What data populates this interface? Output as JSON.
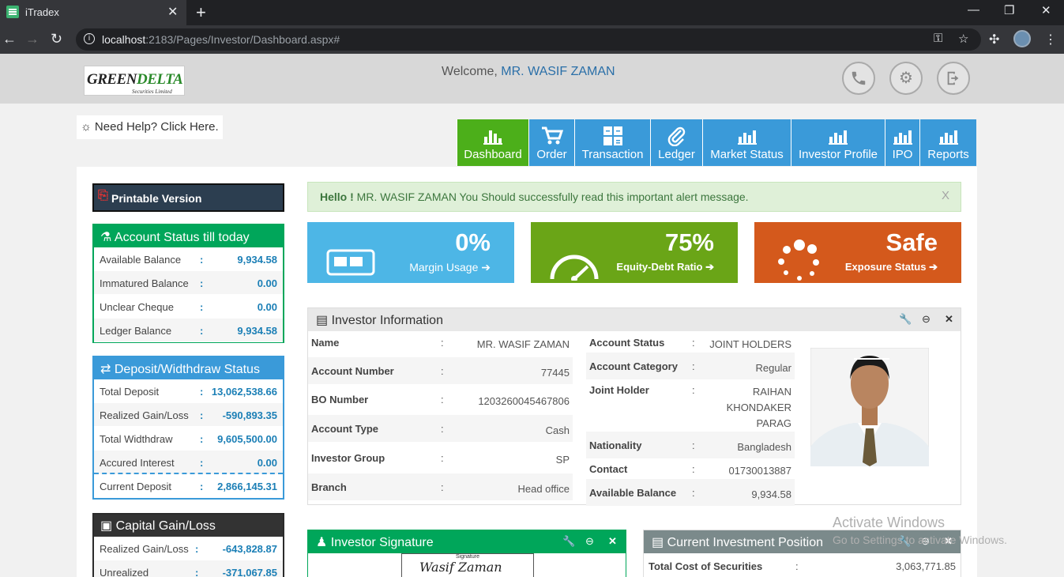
{
  "browser": {
    "tab_title": "iTradex",
    "new_tab": "+",
    "url_host": "localhost",
    "url_rest": ":2183/Pages/Investor/Dashboard.aspx#"
  },
  "header": {
    "logo_text_a": "GREEN",
    "logo_text_b": "DELTA",
    "logo_sub": "Securities Limited",
    "welcome_label": "Welcome,",
    "welcome_name": "MR. WASIF ZAMAN"
  },
  "help": {
    "label": "Need Help? Click Here."
  },
  "menu": [
    {
      "label": "Dashboard",
      "icon": "bar-chart-icon"
    },
    {
      "label": "Order",
      "icon": "cart-icon"
    },
    {
      "label": "Transaction",
      "icon": "calculator-icon"
    },
    {
      "label": "Ledger",
      "icon": "paperclip-icon"
    },
    {
      "label": "Market Status",
      "icon": "line-chart-icon"
    },
    {
      "label": "Investor Profile",
      "icon": "line-chart-icon"
    },
    {
      "label": "IPO",
      "icon": "line-chart-icon"
    },
    {
      "label": "Reports",
      "icon": "line-chart-icon"
    }
  ],
  "printable": {
    "label": "Printable Version"
  },
  "account_status": {
    "title": "Account Status till today",
    "rows": [
      {
        "label": "Available Balance",
        "sep": ":",
        "value": "9,934.58"
      },
      {
        "label": "Immatured Balance",
        "sep": ":",
        "value": "0.00"
      },
      {
        "label": "Unclear Cheque",
        "sep": ":",
        "value": "0.00"
      },
      {
        "label": "Ledger Balance",
        "sep": ":",
        "value": "9,934.58"
      }
    ]
  },
  "deposit_status": {
    "title": "Deposit/Widthdraw Status",
    "rows": [
      {
        "label": "Total Deposit",
        "sep": ":",
        "value": "13,062,538.66"
      },
      {
        "label": "Realized Gain/Loss",
        "sep": ":",
        "value": "-590,893.35"
      },
      {
        "label": "Total Widthdraw",
        "sep": ":",
        "value": "9,605,500.00"
      },
      {
        "label": "Accured Interest",
        "sep": ":",
        "value": "0.00"
      },
      {
        "label": "Current Deposit",
        "sep": ":",
        "value": "2,866,145.31"
      }
    ]
  },
  "capital_gain": {
    "title": "Capital Gain/Loss",
    "rows": [
      {
        "label": "Realized Gain/Loss",
        "sep": ":",
        "value": "-643,828.87"
      },
      {
        "label": "Unrealized",
        "sep": ":",
        "value": "-371,067.85"
      }
    ]
  },
  "alert": {
    "strong": "Hello !",
    "message": "MR. WASIF ZAMAN You Should successfully read this important alert message.",
    "close": "X"
  },
  "tiles": [
    {
      "value": "0%",
      "label": "Margin Usage",
      "color": "#4db6e6"
    },
    {
      "value": "75%",
      "label": "Equity-Debt Ratio",
      "color": "#6aa517"
    },
    {
      "value": "Safe",
      "label": "Exposure Status",
      "color": "#d4591c"
    }
  ],
  "investor_info": {
    "title": "Investor Information",
    "left": [
      {
        "label": "Name",
        "sep": ":",
        "value": "MR. WASIF ZAMAN"
      },
      {
        "label": "Account Number",
        "sep": ":",
        "value": "77445"
      },
      {
        "label": "BO Number",
        "sep": ":",
        "value": "1203260045467806"
      },
      {
        "label": "Account Type",
        "sep": ":",
        "value": "Cash"
      },
      {
        "label": "Investor Group",
        "sep": ":",
        "value": "SP"
      },
      {
        "label": "Branch",
        "sep": ":",
        "value": "Head office"
      }
    ],
    "right": [
      {
        "label": "Account Status",
        "sep": ":",
        "value": "JOINT HOLDERS"
      },
      {
        "label": "Account Category",
        "sep": ":",
        "value": "Regular"
      },
      {
        "label": "Joint Holder",
        "sep": ":",
        "value": "RAIHAN KHONDAKER PARAG"
      },
      {
        "label": "Nationality",
        "sep": ":",
        "value": "Bangladesh"
      },
      {
        "label": "Contact",
        "sep": ":",
        "value": "01730013887"
      },
      {
        "label": "Available Balance",
        "sep": ":",
        "value": "9,934.58"
      }
    ]
  },
  "signature": {
    "title": "Investor Signature",
    "caption": "Signature",
    "script": "Wasif Zaman"
  },
  "investment": {
    "title": "Current Investment Position",
    "rows": [
      {
        "label": "Total Cost of Securities",
        "sep": ":",
        "value": "3,063,771.85"
      }
    ]
  },
  "watermark": {
    "line1": "Activate Windows",
    "line2": "Go to Settings to activate Windows."
  },
  "colors": {
    "green": "#00a65a",
    "blue": "#3a9ad9",
    "dark": "#2c3e50",
    "menu_active": "#4caf1a"
  }
}
